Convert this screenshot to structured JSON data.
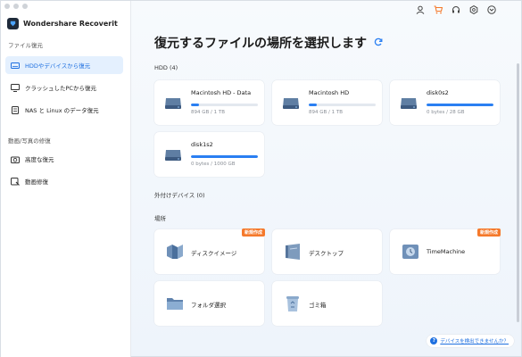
{
  "app": {
    "name": "Wondershare Recoverit"
  },
  "sidebar": {
    "file_recovery_label": "ファイル復元",
    "file_items": [
      {
        "label": "HDDやデバイスから復元",
        "active": true
      },
      {
        "label": "クラッシュしたPCから復元",
        "active": false
      },
      {
        "label": "NAS と Linux のデータ復元",
        "active": false
      }
    ],
    "repair_label": "動画/写真の修復",
    "repair_items": [
      {
        "label": "高度な復元"
      },
      {
        "label": "動画修復"
      }
    ]
  },
  "top_icons": [
    "user-icon",
    "cart-icon",
    "headset-icon",
    "settings-icon",
    "shield-icon"
  ],
  "main": {
    "title": "復元するファイルの場所を選択します",
    "hdd_label": "HDD (4)",
    "drives": [
      {
        "name": "Macintosh HD - Data",
        "size": "894 GB / 1 TB",
        "used_fraction": 0.12
      },
      {
        "name": "Macintosh HD",
        "size": "894 GB / 1 TB",
        "used_fraction": 0.12
      },
      {
        "name": "disk0s2",
        "size": "0 bytes / 28 GB",
        "used_fraction": 1.0
      },
      {
        "name": "disk1s2",
        "size": "0 bytes / 1000 GB",
        "used_fraction": 1.0
      }
    ],
    "external_label": "外付けデバイス (0)",
    "location_label": "場所",
    "locations": [
      {
        "name": "ディスクイメージ",
        "badge": "新規作成"
      },
      {
        "name": "デスクトップ",
        "badge": ""
      },
      {
        "name": "TimeMachine",
        "badge": "新規作成"
      },
      {
        "name": "フォルダ選択",
        "badge": ""
      },
      {
        "name": "ゴミ箱",
        "badge": ""
      }
    ],
    "help_text": "デバイスを検出できませんか？"
  },
  "colors": {
    "accent": "#2a7ff2",
    "badge": "#f5792b",
    "active_bg": "#e4f0fe"
  }
}
